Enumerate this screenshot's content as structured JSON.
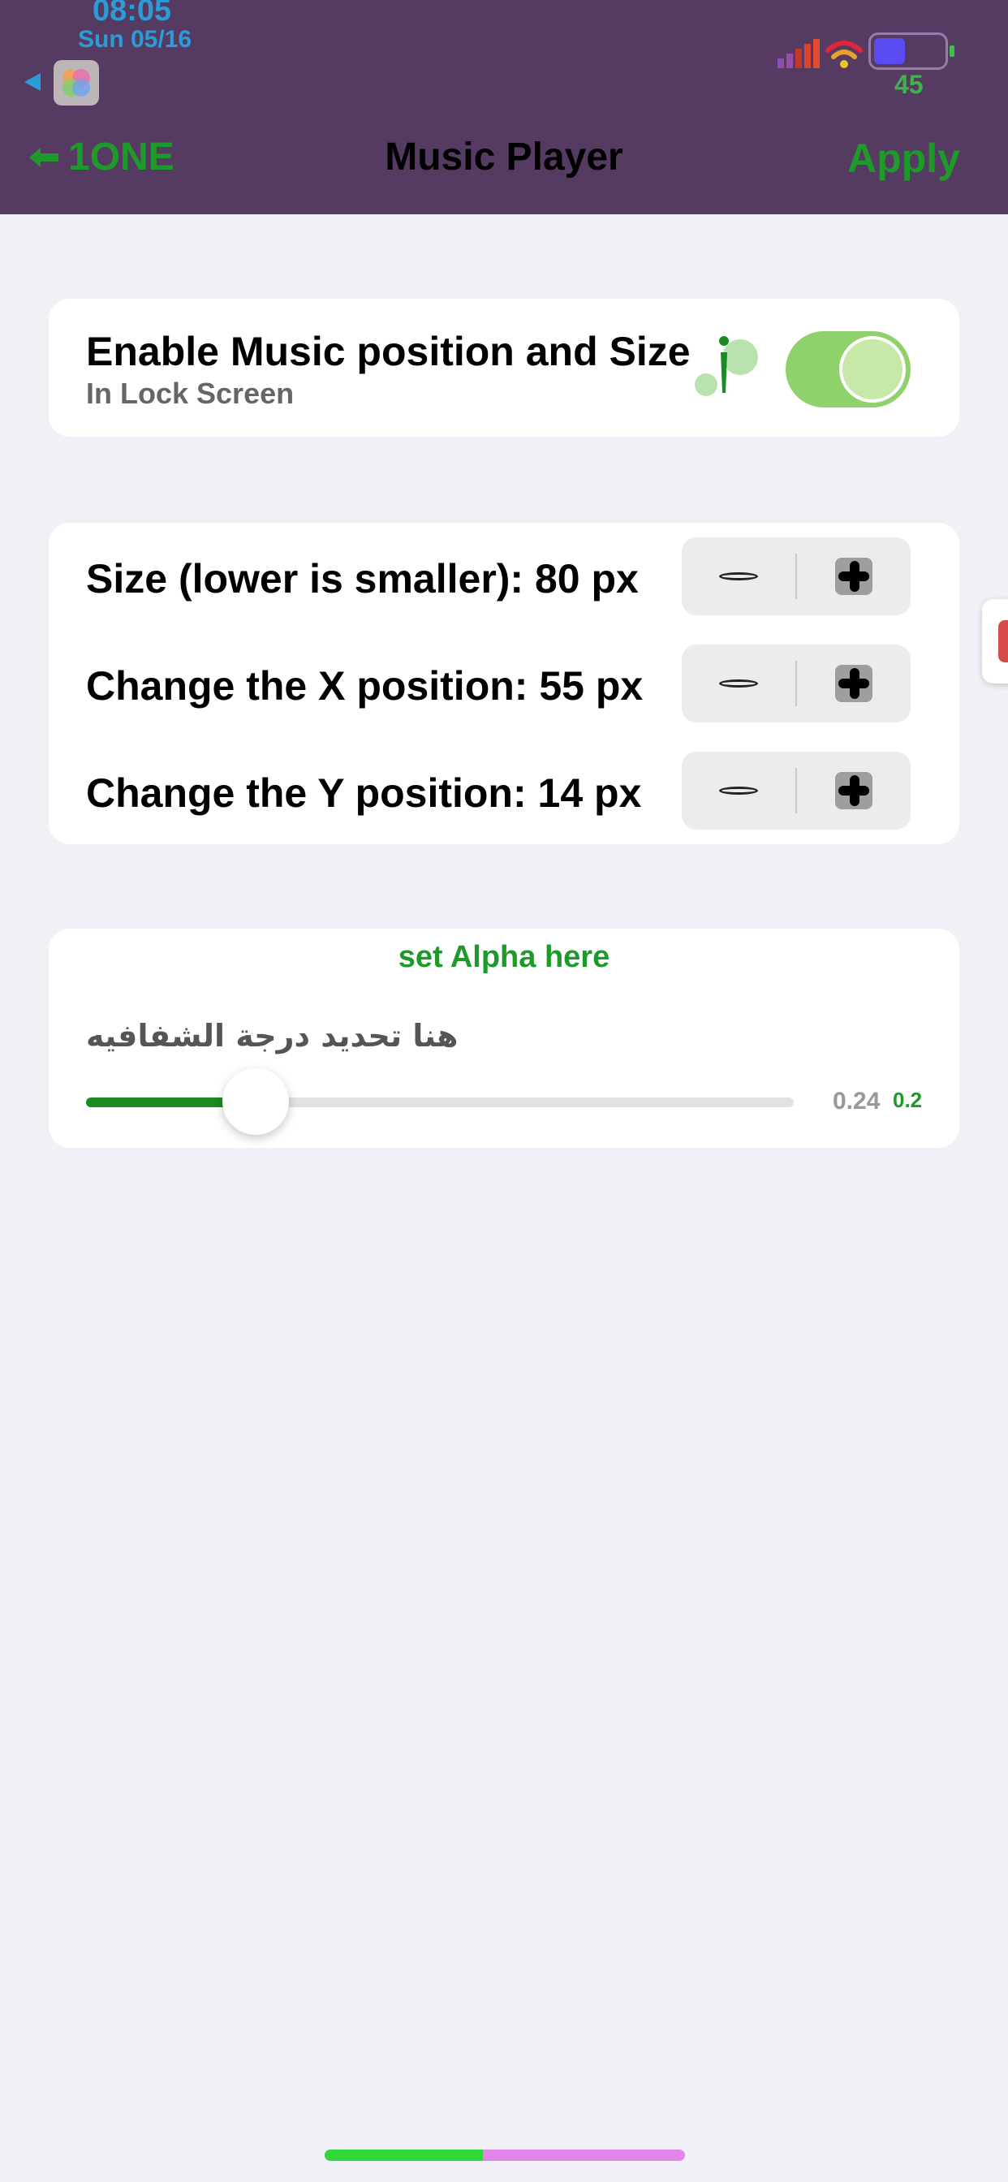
{
  "status_bar": {
    "time": "08:05",
    "date": "Sun 05/16",
    "battery_percent": "45",
    "battery_level": 0.45
  },
  "nav": {
    "back_label": "1ONE",
    "title": "Music Player",
    "apply_label": "Apply"
  },
  "enable_card": {
    "title": "Enable Music position and Size",
    "subtitle": "In Lock Screen",
    "toggle_on": true
  },
  "adjust_card": {
    "rows": [
      {
        "label": "Size (lower is smaller): 80 px"
      },
      {
        "label": "Change the X position: 55 px"
      },
      {
        "label": "Change the Y position: 14 px"
      }
    ]
  },
  "alpha_card": {
    "title": "set Alpha here",
    "arabic_label": "هنا تحديد درجة الشفافيه",
    "slider_value": 0.24,
    "value_text": "0.24",
    "value_text_secondary": "0.2"
  },
  "home_indicator": {
    "progress": 0.44
  },
  "colors": {
    "header_bg": "#553a62",
    "accent_green": "#1e9a2a",
    "status_blue": "#2b9cd8",
    "toggle_green": "#8fd16a",
    "page_bg": "#f1f0f6"
  },
  "icons": {
    "back": "back-arrow-icon",
    "apps": "app-icon",
    "signal": "signal-bars-icon",
    "wifi": "wifi-icon",
    "battery": "battery-icon",
    "minus": "minus-icon",
    "plus": "plus-icon"
  }
}
